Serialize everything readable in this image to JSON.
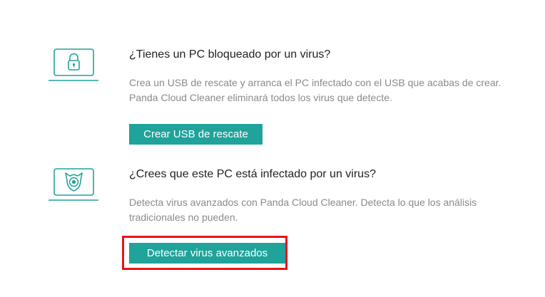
{
  "sections": [
    {
      "icon": "lock-icon",
      "title": "¿Tienes un PC bloqueado por un virus?",
      "description": "Crea un USB de rescate y arranca el PC infectado con el USB que acabas de crear. Panda Cloud Cleaner eliminará todos los virus que detecte.",
      "button_label": "Crear USB de rescate"
    },
    {
      "icon": "panda-shield-icon",
      "title": "¿Crees que este PC está infectado por un virus?",
      "description": "Detecta virus avanzados con Panda Cloud Cleaner. Detecta lo que los análisis tradicionales no pueden.",
      "button_label": "Detectar virus avanzados"
    }
  ],
  "colors": {
    "accent": "#1fa39a",
    "highlight": "#e8141b",
    "title": "#222222",
    "description": "#8a8a8a"
  }
}
